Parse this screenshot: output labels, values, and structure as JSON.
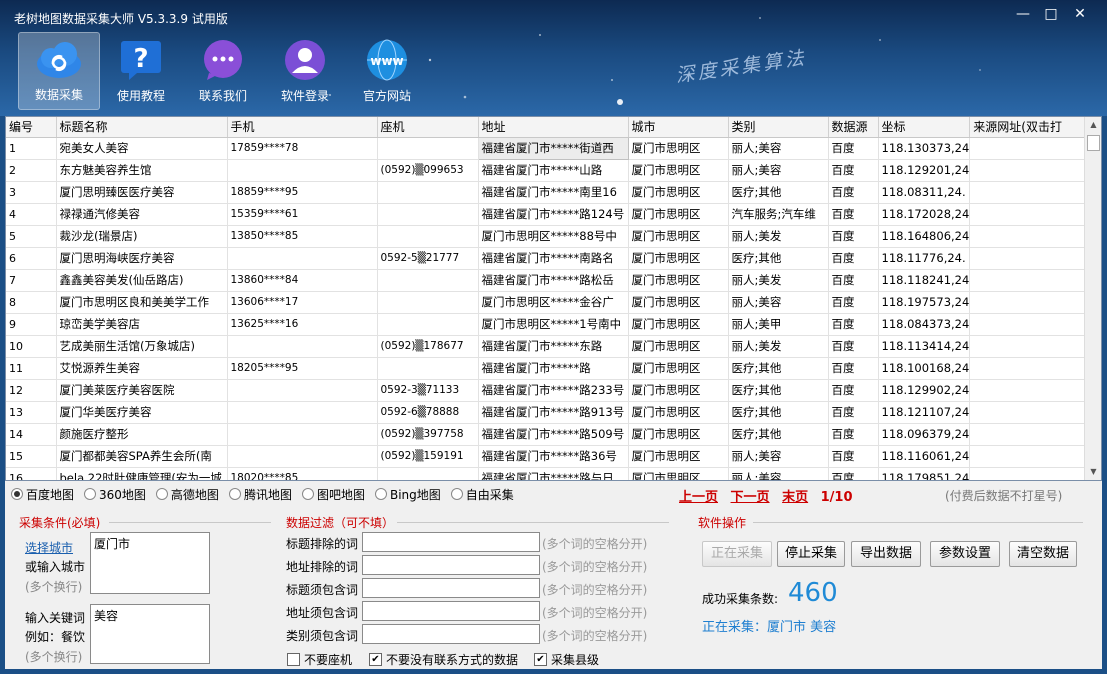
{
  "window": {
    "title": "老树地图数据采集大师 V5.3.3.9 试用版"
  },
  "toolbar": {
    "items": [
      {
        "label": "数据采集",
        "icon": "cloud-sync-icon"
      },
      {
        "label": "使用教程",
        "icon": "question-icon"
      },
      {
        "label": "联系我们",
        "icon": "chat-icon"
      },
      {
        "label": "软件登录",
        "icon": "user-icon"
      },
      {
        "label": "官方网站",
        "icon": "www-globe-icon"
      }
    ],
    "slogan": "深度采集算法"
  },
  "table": {
    "columns": [
      "编号",
      "标题名称",
      "手机",
      "座机",
      "地址",
      "城市",
      "类别",
      "数据源",
      "坐标",
      "来源网址(双击打"
    ],
    "rows": [
      [
        "1",
        "宛美女人美容",
        "17859****78",
        "",
        "福建省厦门市*****街道西",
        "厦门市思明区",
        "丽人;美容",
        "百度",
        "118.130373,24"
      ],
      [
        "2",
        "东方魅美容养生馆",
        "",
        "(0592)▒099653",
        "福建省厦门市*****山路",
        "厦门市思明区",
        "丽人;美容",
        "百度",
        "118.129201,24"
      ],
      [
        "3",
        "厦门思明臻医医疗美容",
        "18859****95",
        "",
        "福建省厦门市*****南里16",
        "厦门市思明区",
        "医疗;其他",
        "百度",
        "118.08311,24."
      ],
      [
        "4",
        "禄禄通汽修美容",
        "15359****61",
        "",
        "福建省厦门市*****路124号",
        "厦门市思明区",
        "汽车服务;汽车维",
        "百度",
        "118.172028,24"
      ],
      [
        "5",
        "裁沙龙(瑞景店)",
        "13850****85",
        "",
        "厦门市思明区*****88号中",
        "厦门市思明区",
        "丽人;美发",
        "百度",
        "118.164806,24"
      ],
      [
        "6",
        "厦门思明海峡医疗美容",
        "",
        "0592-5▒21777",
        "福建省厦门市*****南路名",
        "厦门市思明区",
        "医疗;其他",
        "百度",
        "118.11776,24."
      ],
      [
        "7",
        "鑫鑫美容美发(仙岳路店)",
        "13860****84",
        "",
        "福建省厦门市*****路松岳",
        "厦门市思明区",
        "丽人;美发",
        "百度",
        "118.118241,24"
      ],
      [
        "8",
        "厦门市思明区良和美美学工作",
        "13606****17",
        "",
        "厦门市思明区*****金谷广",
        "厦门市思明区",
        "丽人;美容",
        "百度",
        "118.197573,24"
      ],
      [
        "9",
        "琼峦美学美容店",
        "13625****16",
        "",
        "厦门市思明区*****1号南中",
        "厦门市思明区",
        "丽人;美甲",
        "百度",
        "118.084373,24"
      ],
      [
        "10",
        "艺成美丽生活馆(万象城店)",
        "",
        "(0592)▒178677",
        "福建省厦门市*****东路",
        "厦门市思明区",
        "丽人;美发",
        "百度",
        "118.113414,24"
      ],
      [
        "11",
        "艾悦源养生美容",
        "18205****95",
        "",
        "福建省厦门市*****路",
        "厦门市思明区",
        "医疗;其他",
        "百度",
        "118.100168,24"
      ],
      [
        "12",
        "厦门美莱医疗美容医院",
        "",
        "0592-3▒71133",
        "福建省厦门市*****路233号",
        "厦门市思明区",
        "医疗;其他",
        "百度",
        "118.129902,24"
      ],
      [
        "13",
        "厦门华美医疗美容",
        "",
        "0592-6▒78888",
        "福建省厦门市*****路913号",
        "厦门市思明区",
        "医疗;其他",
        "百度",
        "118.121107,24"
      ],
      [
        "14",
        "颜施医疗整形",
        "",
        "(0592)▒397758",
        "福建省厦门市*****路509号",
        "厦门市思明区",
        "医疗;其他",
        "百度",
        "118.096379,24"
      ],
      [
        "15",
        "厦门都都美容SPA养生会所(南",
        "",
        "(0592)▒159191",
        "福建省厦门市*****路36号",
        "厦门市思明区",
        "丽人;美容",
        "百度",
        "118.116061,24"
      ],
      [
        "16",
        "bela 22时肚健康管理(安为一城",
        "18020****85",
        "",
        "福建省厦门市*****路与日",
        "厦门市思明区",
        "丽人;美容",
        "百度",
        "118.179851,24"
      ]
    ]
  },
  "map_sources": {
    "options": [
      "百度地图",
      "360地图",
      "高德地图",
      "腾讯地图",
      "图吧地图",
      "Bing地图",
      "自由采集"
    ],
    "selected": "百度地图"
  },
  "pager": {
    "prev": "上一页",
    "next": "下一页",
    "last": "末页",
    "page": "1/10"
  },
  "notice": "(付费后数据不打星号)",
  "conditions": {
    "title": "采集条件(必填)",
    "city_link": "选择城市",
    "city_label": "或输入城市",
    "city_hint": "(多个换行)",
    "city_value": "厦门市",
    "kw_label1": "输入关键词",
    "kw_label2": "例如：餐饮",
    "kw_hint": "(多个换行)",
    "kw_value": "美容"
  },
  "filter": {
    "title": "数据过滤（可不填）",
    "rows": [
      {
        "label": "标题排除的词",
        "hint": "(多个词的空格分开)"
      },
      {
        "label": "地址排除的词",
        "hint": "(多个词的空格分开)"
      },
      {
        "label": "标题须包含词",
        "hint": "(多个词的空格分开)"
      },
      {
        "label": "地址须包含词",
        "hint": "(多个词的空格分开)"
      },
      {
        "label": "类别须包含词",
        "hint": "(多个词的空格分开)"
      }
    ],
    "checks": [
      {
        "label": "不要座机",
        "checked": false
      },
      {
        "label": "不要没有联系方式的数据",
        "checked": true
      },
      {
        "label": "采集县级",
        "checked": true
      }
    ]
  },
  "ops": {
    "title": "软件操作",
    "buttons": [
      "正在采集",
      "停止采集",
      "导出数据",
      "参数设置",
      "清空数据"
    ],
    "count_label": "成功采集条数:",
    "count": "460",
    "status": "正在采集：厦门市 美容"
  },
  "colors": {
    "accent_red": "#cc0000",
    "accent_blue": "#1f8ad6",
    "title_bg": "#1a4a80"
  }
}
